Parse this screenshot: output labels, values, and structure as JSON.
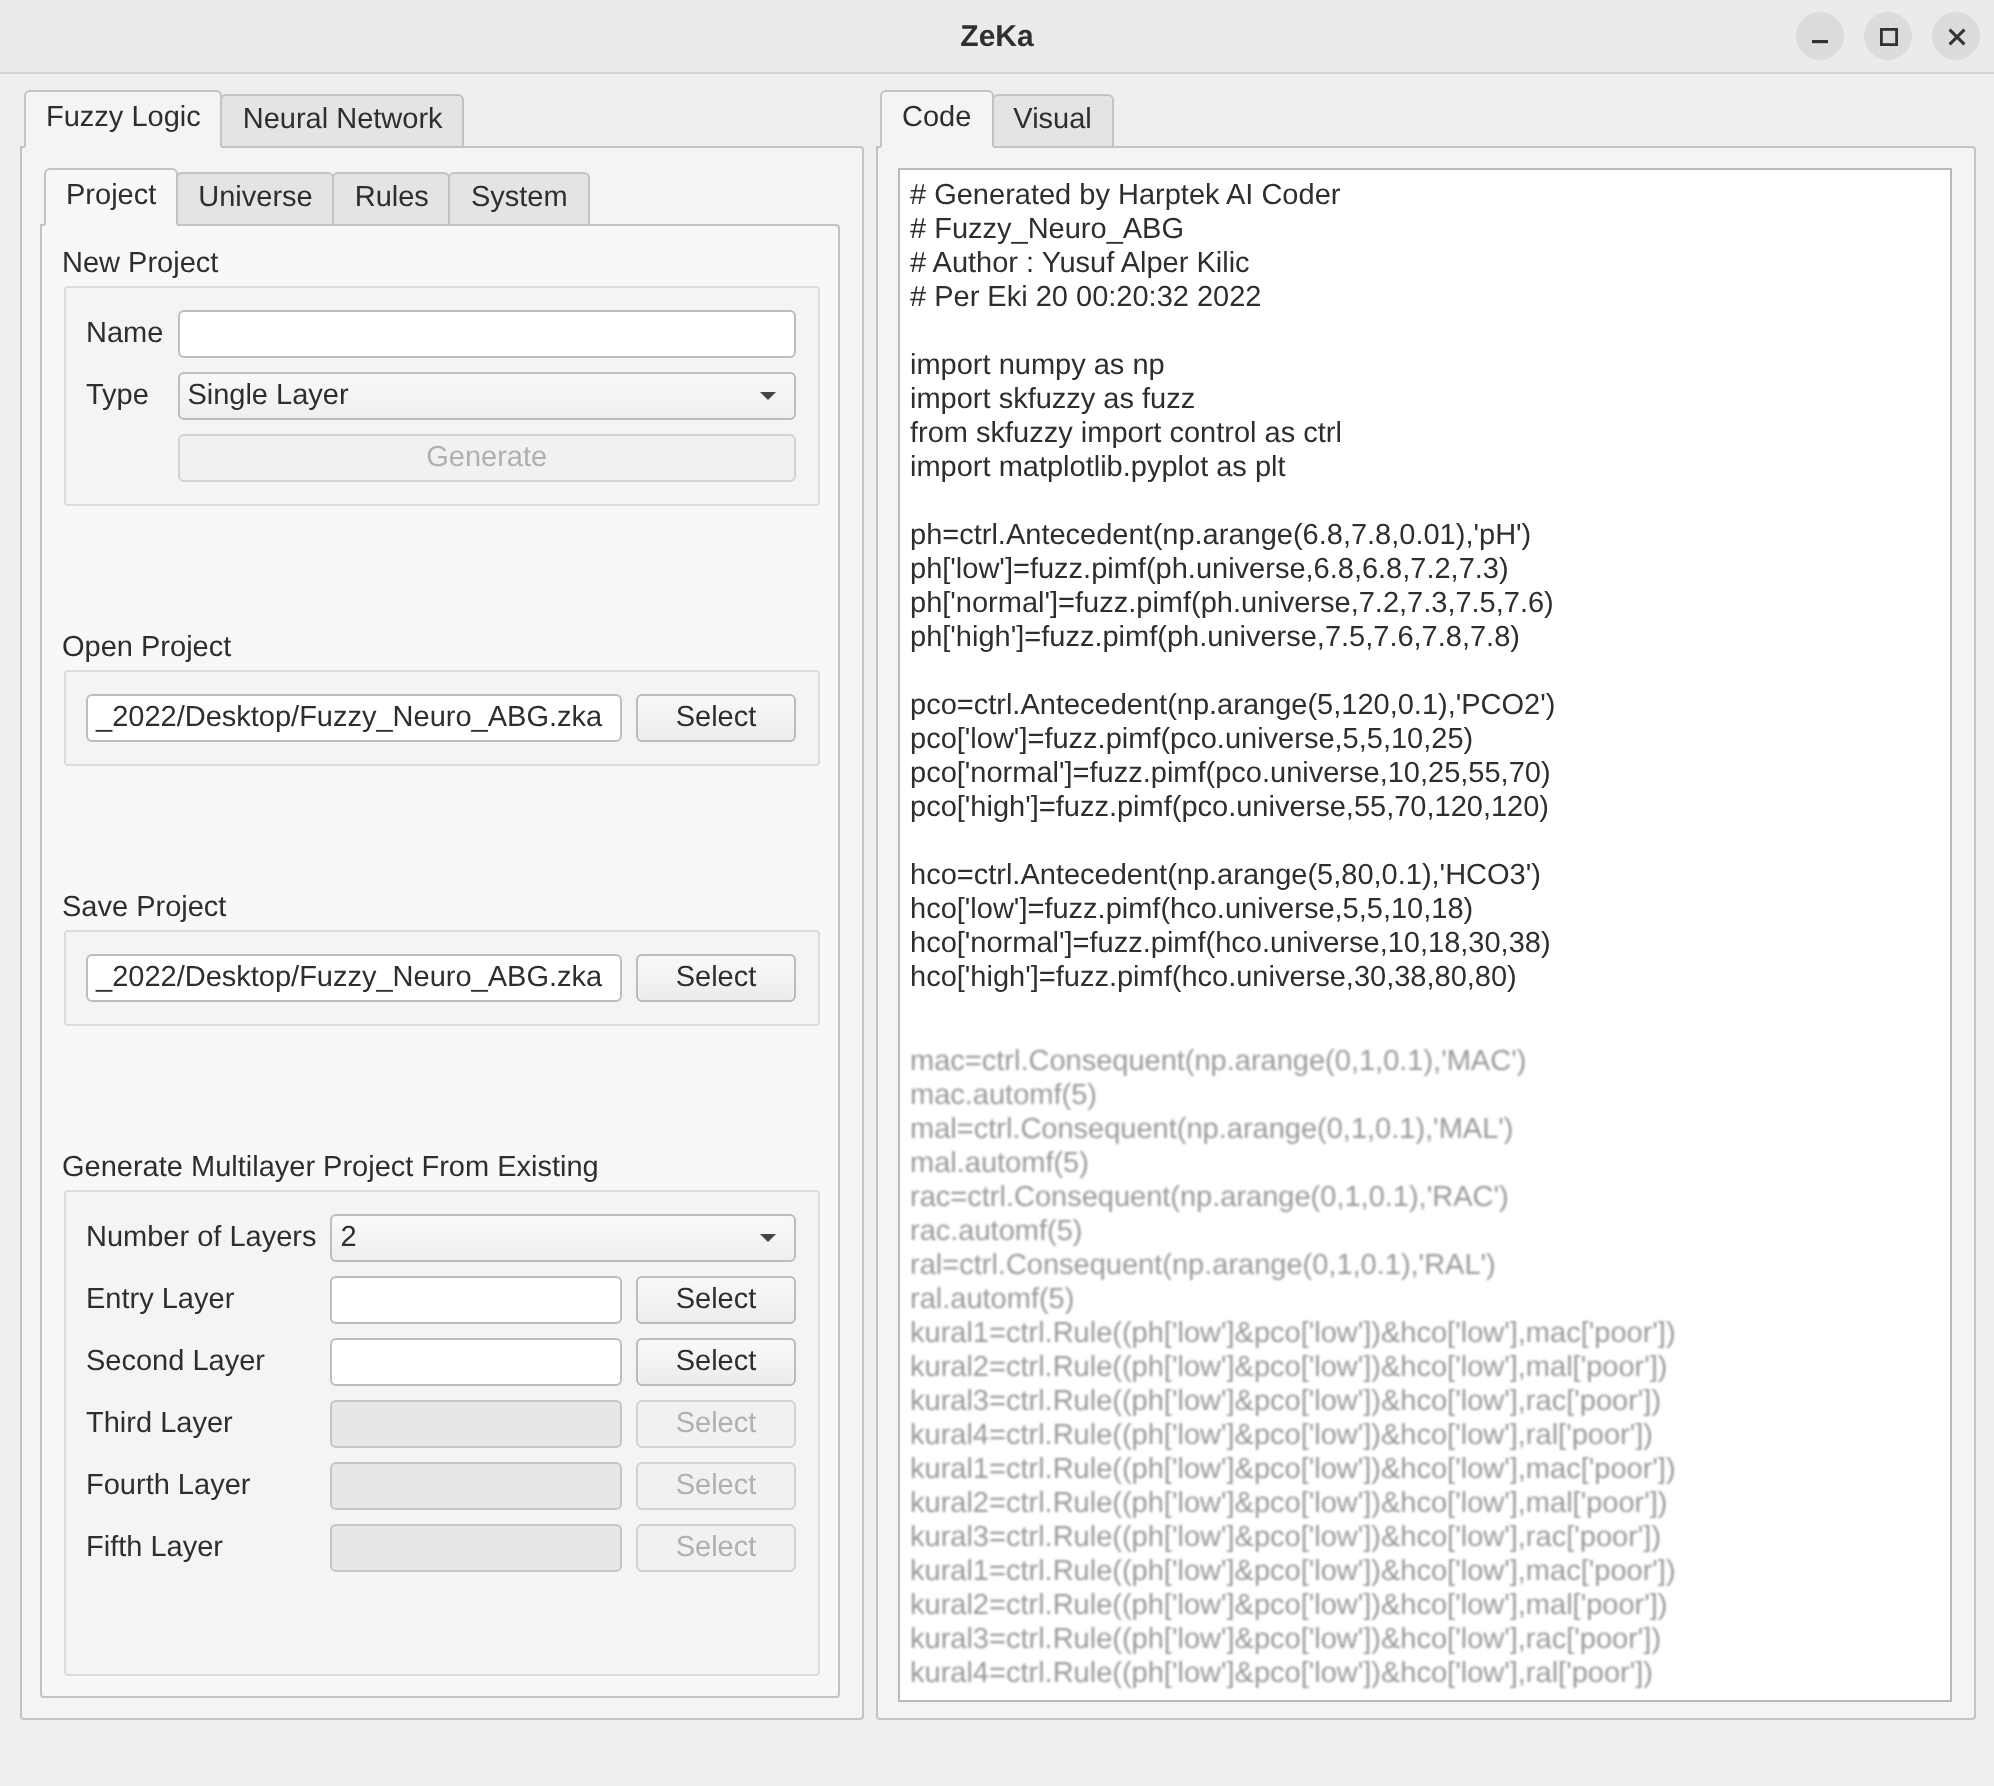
{
  "window": {
    "title": "ZeKa"
  },
  "left_panel": {
    "tabs": [
      {
        "label": "Fuzzy Logic",
        "selected": true
      },
      {
        "label": "Neural Network",
        "selected": false
      }
    ],
    "subtabs": [
      {
        "label": "Project",
        "selected": true
      },
      {
        "label": "Universe",
        "selected": false
      },
      {
        "label": "Rules",
        "selected": false
      },
      {
        "label": "System",
        "selected": false
      }
    ],
    "sections": [
      {
        "title": "New Project",
        "rows": [
          {
            "kind": "text_field",
            "label": "Name",
            "disabled": false
          },
          {
            "kind": "combo",
            "label": "Type",
            "value": "Single Layer",
            "disabled": false
          },
          {
            "kind": "button",
            "label": "Generate",
            "disabled": true
          }
        ]
      },
      {
        "title": "Open Project",
        "rows": [
          {
            "kind": "file",
            "value": "_2022/Desktop/Fuzzy_Neuro_ABG.zka",
            "button": "Select",
            "disabled": false
          }
        ]
      },
      {
        "title": "Save Project",
        "rows": [
          {
            "kind": "file",
            "value": "_2022/Desktop/Fuzzy_Neuro_ABG.zka",
            "button": "Select",
            "disabled": false
          }
        ]
      },
      {
        "title": "Generate Multilayer Project From Existing",
        "rows": [
          {
            "kind": "combo",
            "label": "Number of Layers",
            "value": "2",
            "disabled": false
          },
          {
            "kind": "file",
            "label": "Entry Layer",
            "button": "Select",
            "disabled": false
          },
          {
            "kind": "file",
            "label": "Second Layer",
            "button": "Select",
            "disabled": false
          },
          {
            "kind": "file",
            "label": "Third Layer",
            "button": "Select",
            "disabled": true
          },
          {
            "kind": "file",
            "label": "Fourth Layer",
            "button": "Select",
            "disabled": true
          },
          {
            "kind": "file",
            "label": "Fifth Layer",
            "button": "Select",
            "disabled": true
          }
        ]
      }
    ]
  },
  "right_panel": {
    "tabs": [
      {
        "label": "Code",
        "selected": true
      },
      {
        "label": "Visual",
        "selected": false
      }
    ],
    "code": {
      "blocks": [
        {
          "blurred": false,
          "lines": [
            "# Generated by Harptek AI Coder",
            "# Fuzzy_Neuro_ABG",
            "# Author : Yusuf Alper Kilic",
            "# Per Eki 20 00:20:32 2022"
          ]
        },
        {
          "blurred": false,
          "lines": [
            "import numpy as np",
            "import skfuzzy as fuzz",
            "from skfuzzy import control as ctrl",
            "import matplotlib.pyplot as plt"
          ]
        },
        {
          "blurred": false,
          "lines": [
            "ph=ctrl.Antecedent(np.arange(6.8,7.8,0.01),'pH')",
            "ph['low']=fuzz.pimf(ph.universe,6.8,6.8,7.2,7.3)",
            "ph['normal']=fuzz.pimf(ph.universe,7.2,7.3,7.5,7.6)",
            "ph['high']=fuzz.pimf(ph.universe,7.5,7.6,7.8,7.8)"
          ]
        },
        {
          "blurred": false,
          "lines": [
            "pco=ctrl.Antecedent(np.arange(5,120,0.1),'PCO2')",
            "pco['low']=fuzz.pimf(pco.universe,5,5,10,25)",
            "pco['normal']=fuzz.pimf(pco.universe,10,25,55,70)",
            "pco['high']=fuzz.pimf(pco.universe,55,70,120,120)"
          ]
        },
        {
          "blurred": false,
          "lines": [
            "hco=ctrl.Antecedent(np.arange(5,80,0.1),'HCO3')",
            "hco['low']=fuzz.pimf(hco.universe,5,5,10,18)",
            "hco['normal']=fuzz.pimf(hco.universe,10,18,30,38)",
            "hco['high']=fuzz.pimf(hco.universe,30,38,80,80)"
          ]
        },
        {
          "blurred": true,
          "lines": [
            "mac=ctrl.Consequent(np.arange(0,1,0.1),'MAC')",
            "mac.automf(5)",
            "mal=ctrl.Consequent(np.arange(0,1,0.1),'MAL')",
            "mal.automf(5)",
            "rac=ctrl.Consequent(np.arange(0,1,0.1),'RAC')",
            "rac.automf(5)",
            "ral=ctrl.Consequent(np.arange(0,1,0.1),'RAL')",
            "ral.automf(5)",
            "kural1=ctrl.Rule((ph['low']&pco['low'])&hco['low'],mac['poor'])",
            "kural2=ctrl.Rule((ph['low']&pco['low'])&hco['low'],mal['poor'])",
            "kural3=ctrl.Rule((ph['low']&pco['low'])&hco['low'],rac['poor'])",
            "kural4=ctrl.Rule((ph['low']&pco['low'])&hco['low'],ral['poor'])",
            "kural1=ctrl.Rule((ph['low']&pco['low'])&hco['low'],mac['poor'])",
            "kural2=ctrl.Rule((ph['low']&pco['low'])&hco['low'],mal['poor'])",
            "kural3=ctrl.Rule((ph['low']&pco['low'])&hco['low'],rac['poor'])",
            "kural1=ctrl.Rule((ph['low']&pco['low'])&hco['low'],mac['poor'])",
            "kural2=ctrl.Rule((ph['low']&pco['low'])&hco['low'],mal['poor'])",
            "kural3=ctrl.Rule((ph['low']&pco['low'])&hco['low'],rac['poor'])",
            "kural4=ctrl.Rule((ph['low']&pco['low'])&hco['low'],ral['poor'])"
          ]
        }
      ]
    }
  }
}
